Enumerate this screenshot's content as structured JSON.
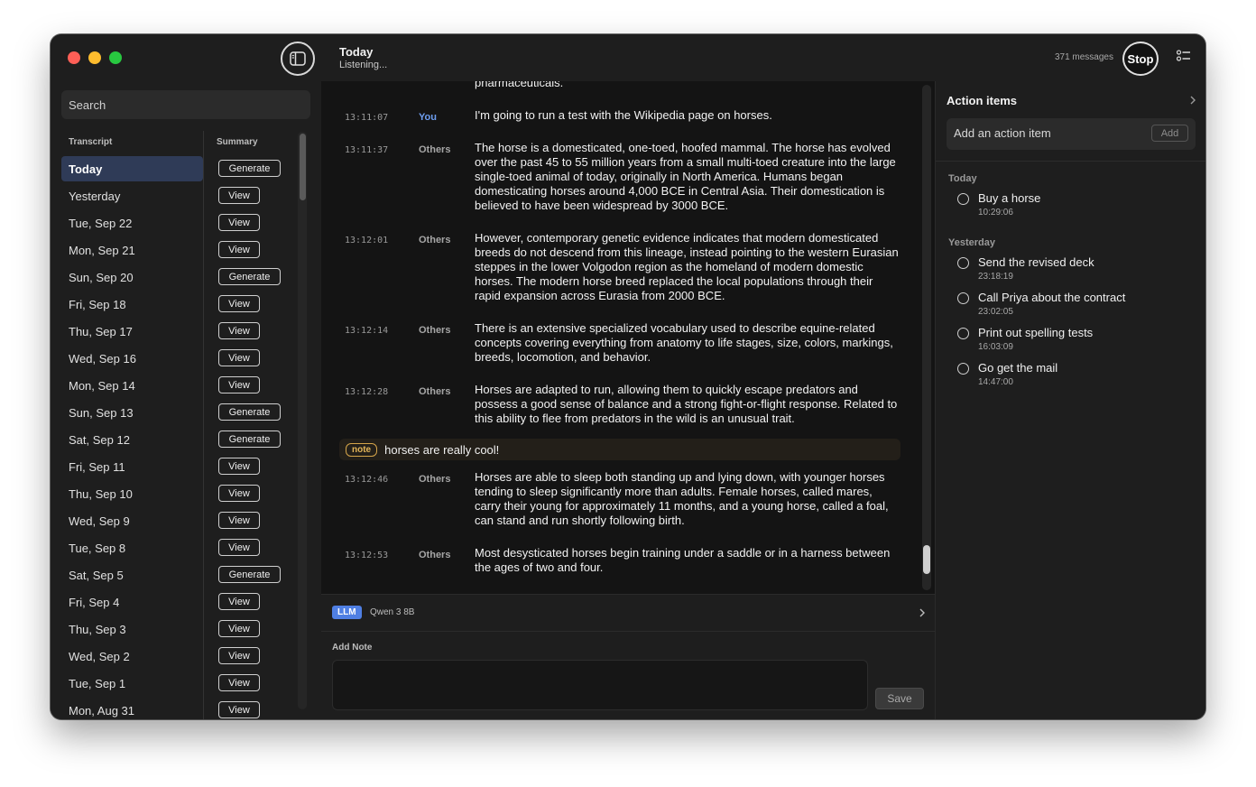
{
  "window": {
    "title": "Today",
    "subtitle": "Listening...",
    "message_count": "371 messages",
    "stop_label": "Stop"
  },
  "sidebar": {
    "search_placeholder": "Search",
    "col_transcript": "Transcript",
    "col_summary": "Summary",
    "rows": [
      {
        "label": "Today",
        "action": "Generate",
        "active": true
      },
      {
        "label": "Yesterday",
        "action": "View"
      },
      {
        "label": "Tue, Sep 22",
        "action": "View"
      },
      {
        "label": "Mon, Sep 21",
        "action": "View"
      },
      {
        "label": "Sun, Sep 20",
        "action": "Generate"
      },
      {
        "label": "Fri, Sep 18",
        "action": "View"
      },
      {
        "label": "Thu, Sep 17",
        "action": "View"
      },
      {
        "label": "Wed, Sep 16",
        "action": "View"
      },
      {
        "label": "Mon, Sep 14",
        "action": "View"
      },
      {
        "label": "Sun, Sep 13",
        "action": "Generate"
      },
      {
        "label": "Sat, Sep 12",
        "action": "Generate"
      },
      {
        "label": "Fri, Sep 11",
        "action": "View"
      },
      {
        "label": "Thu, Sep 10",
        "action": "View"
      },
      {
        "label": "Wed, Sep 9",
        "action": "View"
      },
      {
        "label": "Tue, Sep 8",
        "action": "View"
      },
      {
        "label": "Sat, Sep 5",
        "action": "Generate"
      },
      {
        "label": "Fri, Sep 4",
        "action": "View"
      },
      {
        "label": "Thu, Sep 3",
        "action": "View"
      },
      {
        "label": "Wed, Sep 2",
        "action": "View"
      },
      {
        "label": "Tue, Sep 1",
        "action": "View"
      },
      {
        "label": "Mon, Aug 31",
        "action": "View"
      }
    ]
  },
  "transcript": {
    "clipped_top": "pharmaceuticals.",
    "entries": [
      {
        "time": "13:11:07",
        "speaker": "You",
        "text": "I'm going to run a test with the Wikipedia page on horses."
      },
      {
        "time": "13:11:37",
        "speaker": "Others",
        "text": "The horse is a domesticated, one-toed, hoofed mammal. The horse has evolved over the past 45 to 55 million years from a small multi-toed creature into the large single-toed animal of today, originally in North America. Humans began domesticating horses around 4,000 BCE in Central Asia. Their domestication is believed to have been widespread by 3000 BCE."
      },
      {
        "time": "13:12:01",
        "speaker": "Others",
        "text": "However, contemporary genetic evidence indicates that modern domesticated breeds do not descend from this lineage, instead pointing to the western Eurasian steppes in the lower Volgodon region as the homeland of modern domestic horses. The modern horse breed replaced the local populations through their rapid expansion across Eurasia from 2000 BCE."
      },
      {
        "time": "13:12:14",
        "speaker": "Others",
        "text": "There is an extensive specialized vocabulary used to describe equine-related concepts covering everything from anatomy to life stages, size, colors, markings, breeds, locomotion, and behavior."
      },
      {
        "time": "13:12:28",
        "speaker": "Others",
        "text": "Horses are adapted to run, allowing them to quickly escape predators and possess a good sense of balance and a strong fight-or-flight response. Related to this ability to flee from predators in the wild is an unusual trait."
      },
      {
        "time": "13:12:46",
        "speaker": "Others",
        "text": "Horses are able to sleep both standing up and lying down, with younger horses tending to sleep significantly more than adults. Female horses, called mares, carry their young for approximately 11 months, and a young horse, called a foal, can stand and run shortly following birth."
      },
      {
        "time": "13:12:53",
        "speaker": "Others",
        "text": "Most desysticated horses begin training under a saddle or in a harness between the ages of two and four."
      }
    ],
    "note": {
      "badge": "note",
      "text": "horses are really cool!"
    }
  },
  "llm": {
    "badge": "LLM",
    "model": "Qwen 3 8B"
  },
  "add_note": {
    "label": "Add Note",
    "save_label": "Save"
  },
  "action_items": {
    "title": "Action items",
    "input_placeholder": "Add an action item",
    "add_label": "Add",
    "groups": [
      {
        "label": "Today",
        "items": [
          {
            "title": "Buy a horse",
            "time": "10:29:06"
          }
        ]
      },
      {
        "label": "Yesterday",
        "items": [
          {
            "title": "Send the revised deck",
            "time": "23:18:19"
          },
          {
            "title": "Call Priya about the contract",
            "time": "23:02:05"
          },
          {
            "title": "Print out spelling tests",
            "time": "16:03:09"
          },
          {
            "title": "Go get the mail",
            "time": "14:47:00"
          }
        ]
      }
    ]
  },
  "colors": {
    "accent_blue": "#4f7fe3",
    "note_gold": "#d5a54a",
    "active_row": "#2f3b57"
  }
}
